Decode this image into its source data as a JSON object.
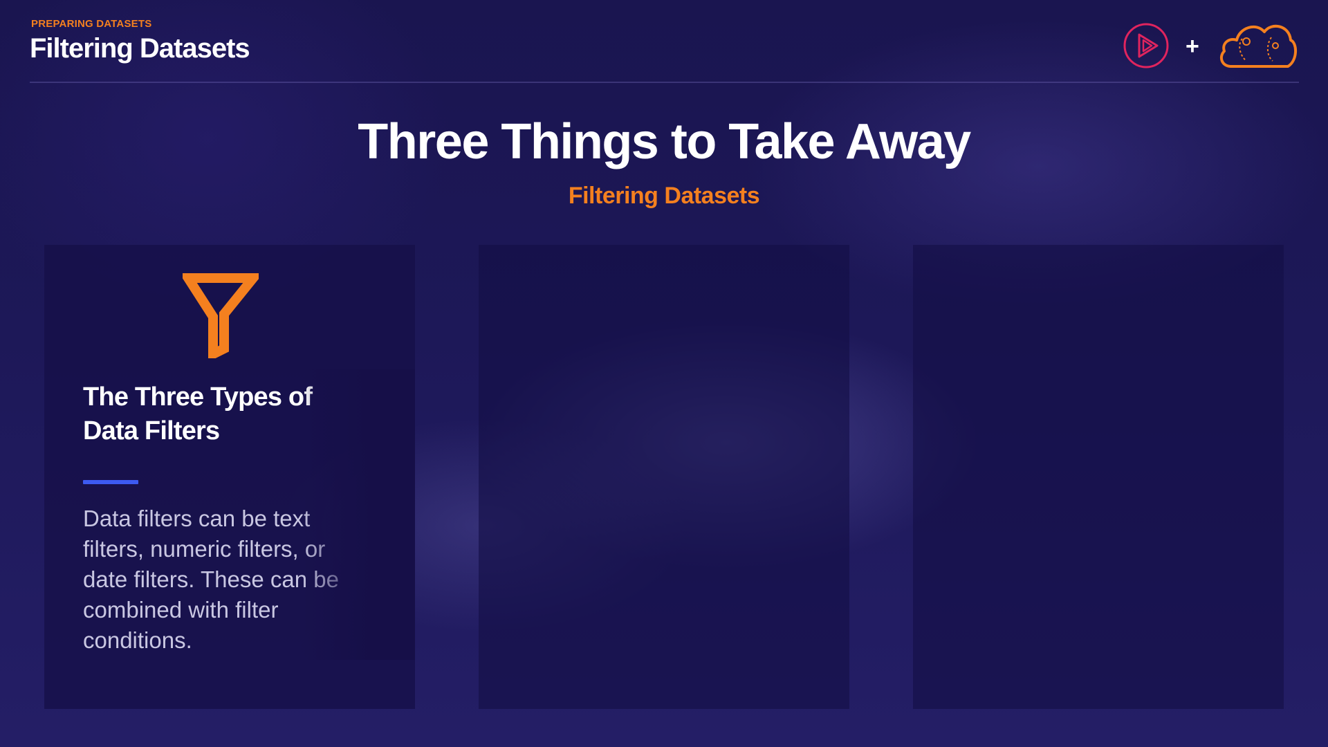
{
  "header": {
    "eyebrow": "PREPARING DATASETS",
    "title": "Filtering Datasets"
  },
  "logos": {
    "play_icon": "pluralsight-play-icon",
    "plus": "+",
    "cloud_icon": "cloud-icon",
    "play_color": "#e0245e",
    "cloud_color": "#f4801f"
  },
  "slide": {
    "title": "Three Things to Take Away",
    "subtitle": "Filtering Datasets"
  },
  "cards": [
    {
      "icon": "filter-icon",
      "heading": "The Three Types of Data Filters",
      "body": "Data filters can be text filters, numeric filters, or date filters. These can be combined with filter conditions."
    },
    {},
    {}
  ],
  "colors": {
    "accent_orange": "#f4801f",
    "accent_blue": "#3d5af1",
    "background": "#1c1650"
  }
}
